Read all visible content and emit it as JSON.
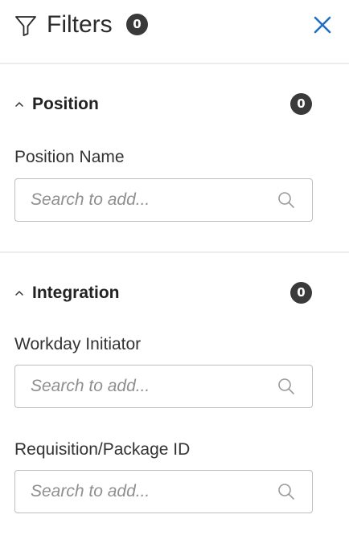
{
  "header": {
    "title": "Filters",
    "count": "0",
    "icons": {
      "filter": "filter-funnel-icon",
      "close": "close-x-icon"
    }
  },
  "sections": [
    {
      "title": "Position",
      "count": "0",
      "fields": [
        {
          "label": "Position Name",
          "placeholder": "Search to add..."
        }
      ]
    },
    {
      "title": "Integration",
      "count": "0",
      "fields": [
        {
          "label": "Workday Initiator",
          "placeholder": "Search to add..."
        },
        {
          "label": "Requisition/Package ID",
          "placeholder": "Search to add..."
        }
      ]
    }
  ],
  "colors": {
    "accent": "#1f6fc5",
    "badge_bg": "#3a3a3a",
    "divider": "#ececec",
    "input_border": "#bdbdbd"
  }
}
